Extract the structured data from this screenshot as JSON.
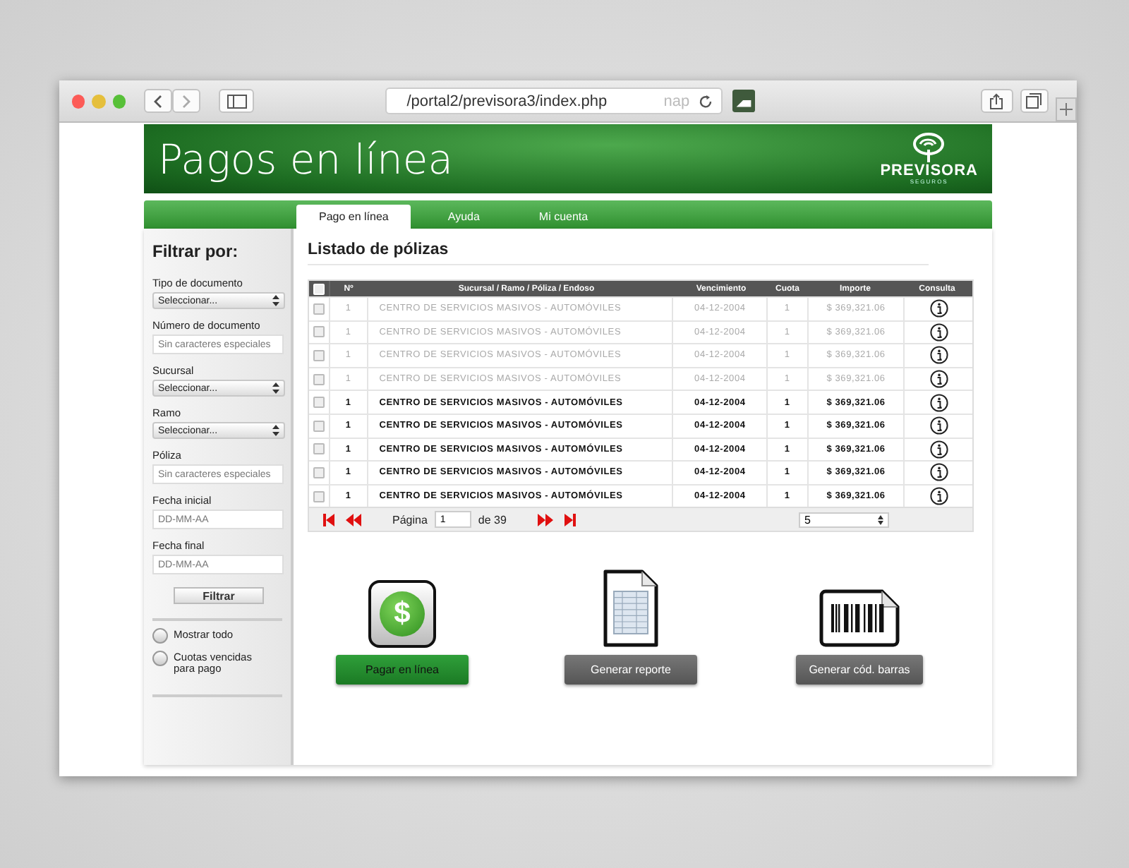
{
  "browser": {
    "url": "/portal2/previsora3/index.php",
    "url_hint": "nap"
  },
  "header": {
    "title": "Pagos en línea",
    "logo_name": "PREVISORA",
    "logo_sub": "SEGUROS"
  },
  "tabs": [
    {
      "label": "Pago en línea",
      "selected": true
    },
    {
      "label": "Ayuda",
      "selected": false
    },
    {
      "label": "Mi cuenta",
      "selected": false
    }
  ],
  "sidebar": {
    "title": "Filtrar por:",
    "fields": [
      {
        "kind": "select",
        "label": "Tipo de documento",
        "value": "Seleccionar..."
      },
      {
        "kind": "input",
        "label": "Número de documento",
        "placeholder": "Sin caracteres especiales"
      },
      {
        "kind": "select",
        "label": "Sucursal",
        "value": "Seleccionar..."
      },
      {
        "kind": "select",
        "label": "Ramo",
        "value": "Seleccionar..."
      },
      {
        "kind": "input",
        "label": "Póliza",
        "placeholder": "Sin caracteres especiales"
      },
      {
        "kind": "input",
        "label": "Fecha inicial",
        "placeholder": "DD-MM-AA"
      },
      {
        "kind": "input",
        "label": "Fecha final",
        "placeholder": "DD-MM-AA"
      }
    ],
    "button": "Filtrar",
    "options": [
      {
        "label": "Mostrar todo",
        "selected": false
      },
      {
        "label": "Cuotas vencidas para pago",
        "selected": false
      }
    ]
  },
  "main": {
    "title": "Listado de pólizas",
    "table": {
      "columns": [
        "Nº",
        "Sucursal / Ramo / Póliza / Endoso",
        "Vencimiento",
        "Cuota",
        "Importe",
        "Consulta"
      ],
      "select_all": false,
      "rows": [
        {
          "checked": false,
          "disabled": true,
          "cells": [
            "1",
            "CENTRO DE SERVICIOS MASIVOS - AUTOMÓVILES",
            "04-12-2004",
            "1",
            "$ 369,321.06"
          ]
        },
        {
          "checked": false,
          "disabled": true,
          "cells": [
            "1",
            "CENTRO DE SERVICIOS MASIVOS - AUTOMÓVILES",
            "04-12-2004",
            "1",
            "$ 369,321.06"
          ]
        },
        {
          "checked": false,
          "disabled": true,
          "cells": [
            "1",
            "CENTRO DE SERVICIOS MASIVOS - AUTOMÓVILES",
            "04-12-2004",
            "1",
            "$ 369,321.06"
          ]
        },
        {
          "checked": false,
          "disabled": true,
          "cells": [
            "1",
            "CENTRO DE SERVICIOS MASIVOS - AUTOMÓVILES",
            "04-12-2004",
            "1",
            "$ 369,321.06"
          ]
        },
        {
          "checked": false,
          "disabled": false,
          "cells": [
            "1",
            "CENTRO DE SERVICIOS MASIVOS - AUTOMÓVILES",
            "04-12-2004",
            "1",
            "$ 369,321.06"
          ]
        },
        {
          "checked": false,
          "disabled": false,
          "cells": [
            "1",
            "CENTRO DE SERVICIOS MASIVOS - AUTOMÓVILES",
            "04-12-2004",
            "1",
            "$ 369,321.06"
          ]
        },
        {
          "checked": false,
          "disabled": false,
          "cells": [
            "1",
            "CENTRO DE SERVICIOS MASIVOS - AUTOMÓVILES",
            "04-12-2004",
            "1",
            "$ 369,321.06"
          ]
        },
        {
          "checked": false,
          "disabled": false,
          "cells": [
            "1",
            "CENTRO DE SERVICIOS MASIVOS - AUTOMÓVILES",
            "04-12-2004",
            "1",
            "$ 369,321.06"
          ]
        },
        {
          "checked": false,
          "disabled": false,
          "cells": [
            "1",
            "CENTRO DE SERVICIOS MASIVOS - AUTOMÓVILES",
            "04-12-2004",
            "1",
            "$ 369,321.06"
          ]
        }
      ],
      "pager": {
        "label": "Página",
        "page": "1",
        "of": "de 39",
        "per_page": "5"
      }
    },
    "actions": [
      {
        "kind": "pay",
        "icon_glyph": "$",
        "label": "Pagar en línea"
      },
      {
        "kind": "report",
        "label": "Generar reporte"
      },
      {
        "kind": "barcode",
        "label": "Generar cód. barras"
      }
    ]
  }
}
